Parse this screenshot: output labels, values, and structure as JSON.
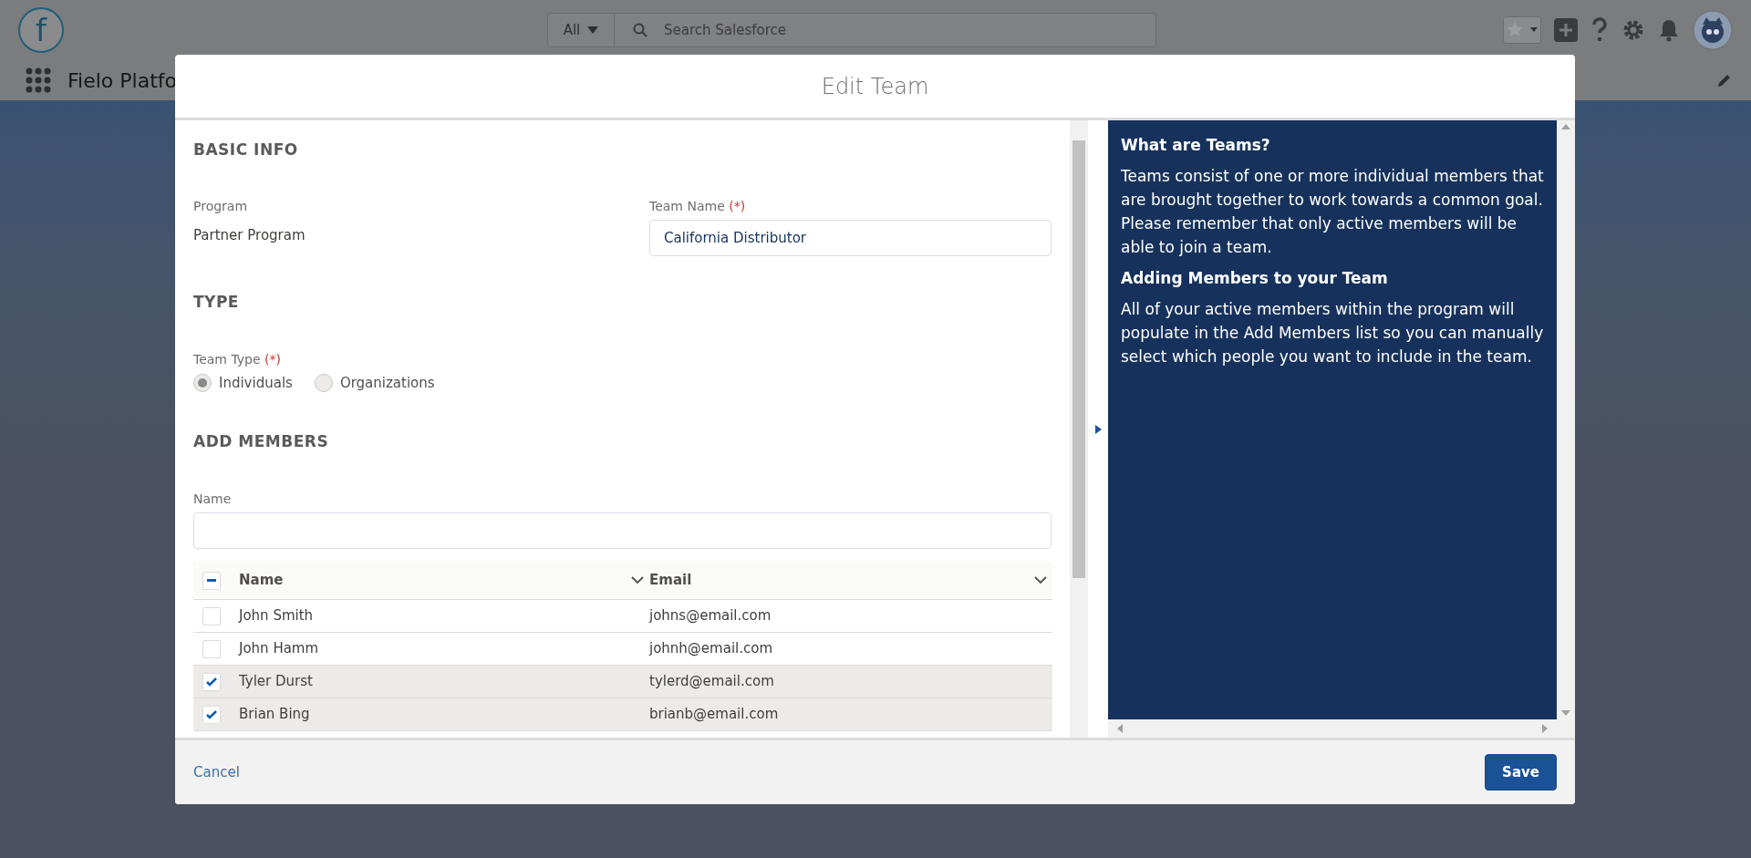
{
  "global_header": {
    "logo_letter": "f",
    "search_scope": "All",
    "search_placeholder": "Search Salesforce"
  },
  "app_bar": {
    "app_name": "Fielo Platfo"
  },
  "modal": {
    "title": "Edit Team",
    "basic_info": {
      "heading": "BASIC INFO",
      "program_label": "Program",
      "program_value": "Partner Program",
      "team_name_label": "Team Name",
      "required_mark": "(*)",
      "team_name_value": "California Distributor"
    },
    "type": {
      "heading": "TYPE",
      "team_type_label": "Team Type",
      "required_mark": "(*)",
      "options": [
        {
          "label": "Individuals",
          "selected": true
        },
        {
          "label": "Organizations",
          "selected": false
        }
      ]
    },
    "add_members": {
      "heading": "ADD MEMBERS",
      "name_filter_label": "Name",
      "table": {
        "select_all_indeterminate": true,
        "columns": [
          "Name",
          "Email"
        ],
        "rows": [
          {
            "name": "John Smith",
            "email": "johns@email.com",
            "checked": false
          },
          {
            "name": "John Hamm",
            "email": "johnh@email.com",
            "checked": false
          },
          {
            "name": "Tyler Durst",
            "email": "tylerd@email.com",
            "checked": true
          },
          {
            "name": "Brian Bing",
            "email": "brianb@email.com",
            "checked": true
          }
        ]
      }
    },
    "help": [
      {
        "heading": "What are Teams?",
        "body": "Teams consist of one or more individual members that are brought together to work towards a common goal. Please remember that only active members will be able to join a team."
      },
      {
        "heading": "Adding Members to your Team",
        "body": "All of your active members within the program will populate in the Add Members list so you can manually select which people you want to include in the team."
      }
    ],
    "footer": {
      "cancel": "Cancel",
      "save": "Save"
    }
  }
}
